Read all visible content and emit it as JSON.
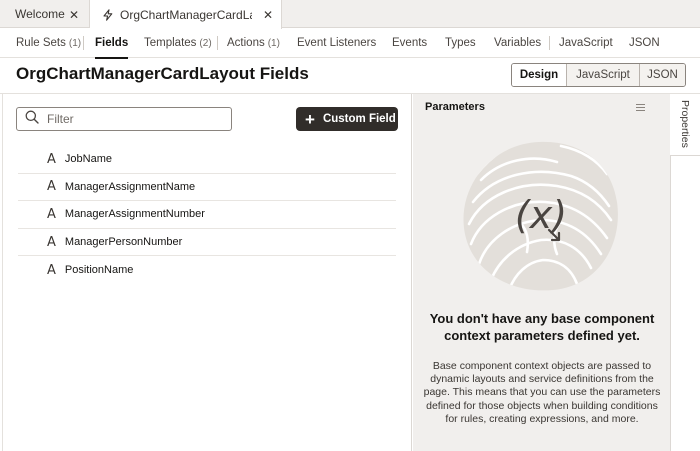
{
  "top_tabs": {
    "welcome_label": "Welcome",
    "active_label": "OrgChartManagerCardLayout",
    "close_glyph": "✕"
  },
  "sub_tabs": [
    {
      "label": "Rule Sets",
      "count": "(1)"
    },
    {
      "label": "Fields",
      "count": ""
    },
    {
      "label": "Templates",
      "count": "(2)"
    },
    {
      "label": "Actions",
      "count": "(1)"
    },
    {
      "label": "Event Listeners",
      "count": ""
    },
    {
      "label": "Events",
      "count": ""
    },
    {
      "label": "Types",
      "count": ""
    },
    {
      "label": "Variables",
      "count": ""
    },
    {
      "label": "JavaScript",
      "count": ""
    },
    {
      "label": "JSON",
      "count": ""
    }
  ],
  "page": {
    "title": "OrgChartManagerCardLayout Fields"
  },
  "view_switch": {
    "design": "Design",
    "javascript": "JavaScript",
    "json": "JSON",
    "selected": "Design"
  },
  "filter": {
    "placeholder": "Filter",
    "value": ""
  },
  "custom_field_button": {
    "label": "Custom Field"
  },
  "fields": [
    {
      "type_glyph": "A",
      "name": "JobName"
    },
    {
      "type_glyph": "A",
      "name": "ManagerAssignmentName"
    },
    {
      "type_glyph": "A",
      "name": "ManagerAssignmentNumber"
    },
    {
      "type_glyph": "A",
      "name": "ManagerPersonNumber"
    },
    {
      "type_glyph": "A",
      "name": "PositionName"
    }
  ],
  "parameters_panel": {
    "title": "Parameters",
    "illustration_text": "(x)",
    "empty_title": "You don't have any base component context parameters defined yet.",
    "empty_description": "Base component context objects are passed to dynamic layouts and service definitions from the page. This means that you can use the parameters defined for those objects when building conditions for rules, creating expressions, and more."
  },
  "side_rail": {
    "properties_label": "Properties"
  },
  "colors": {
    "primary_button": "#312d2a",
    "panel_bg": "#f1efed",
    "text": "#161513"
  }
}
